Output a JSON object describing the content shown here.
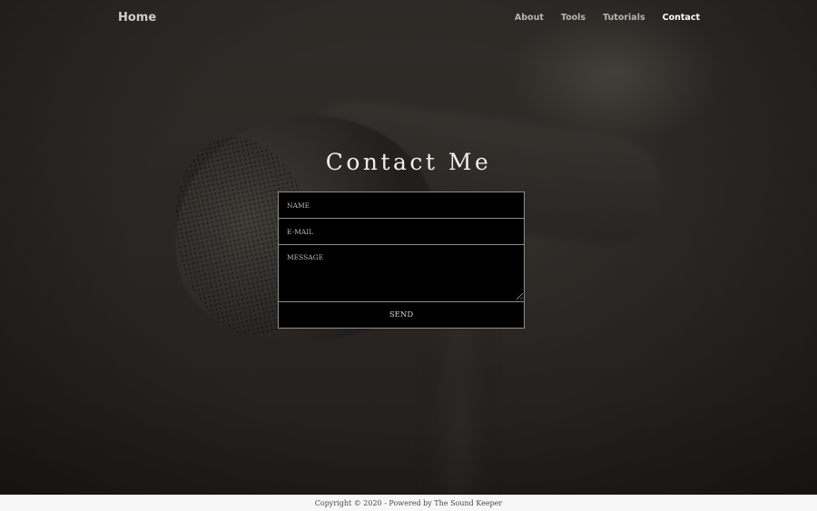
{
  "nav": {
    "brand": "Home",
    "links": [
      {
        "label": "About",
        "active": false
      },
      {
        "label": "Tools",
        "active": false
      },
      {
        "label": "Tutorials",
        "active": false
      },
      {
        "label": "Contact",
        "active": true
      }
    ]
  },
  "main": {
    "title": "Contact Me"
  },
  "form": {
    "name_placeholder": "NAME",
    "email_placeholder": "E-MAIL",
    "message_placeholder": "MESSAGE",
    "send_label": "SEND"
  },
  "footer": {
    "text": "Copyright © 2020 - Powered by The Sound Keeper"
  },
  "colors": {
    "accent": "#ffffff",
    "nav_inactive": "#b9b5b0",
    "field_background": "#000000",
    "footer_background": "#f7f7f8"
  },
  "icons": {
    "resize_grip": "resize-grip-icon"
  }
}
